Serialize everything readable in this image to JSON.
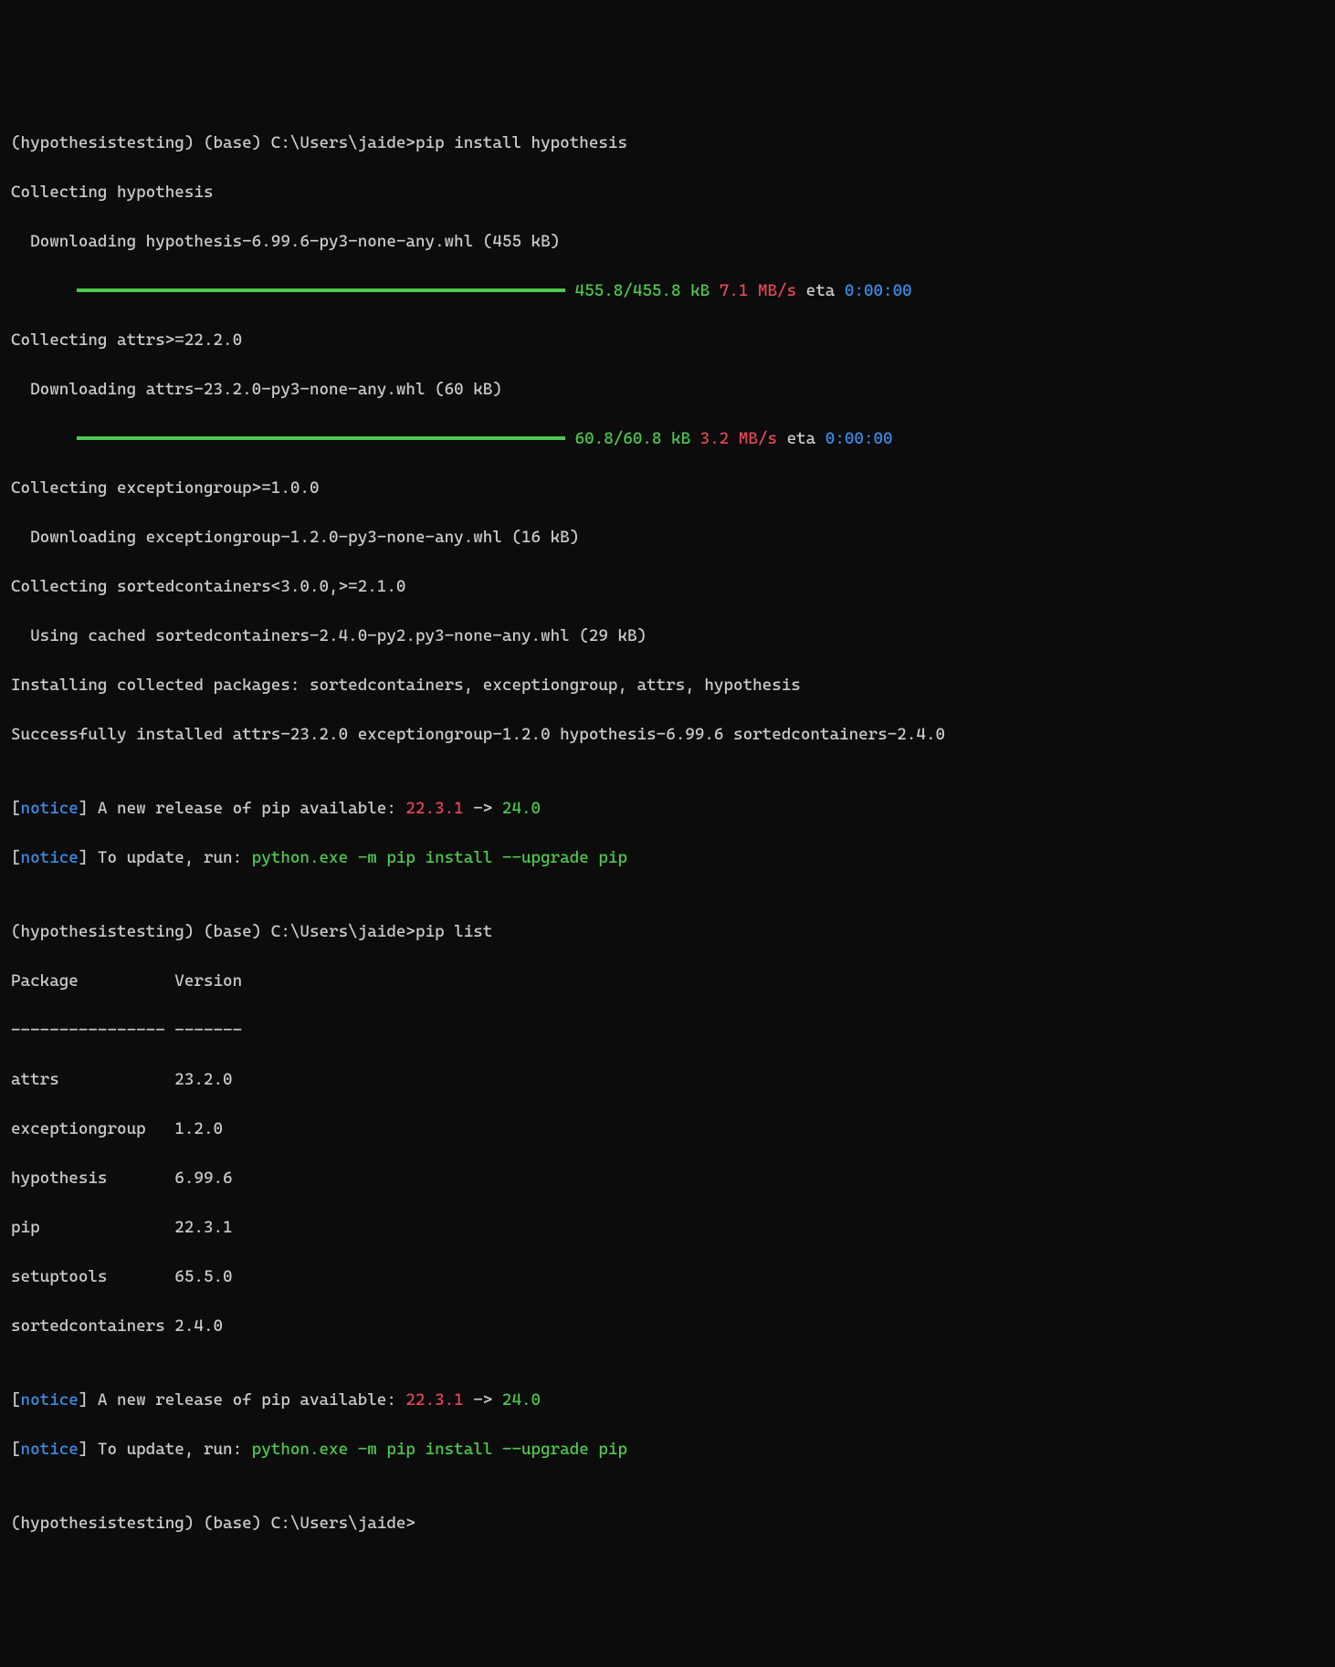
{
  "prompt": "(hypothesistesting) (base) C:\\Users\\jaide>",
  "cmd1": "pip install hypothesis",
  "cmd2": "pip list",
  "collecting_hypothesis": "Collecting hypothesis",
  "download_hypothesis": "  Downloading hypothesis-6.99.6-py3-none-any.whl (455 kB)",
  "progress1_size": "455.8/455.8 kB",
  "progress1_speed": "7.1 MB/s",
  "progress1_eta_label": "eta",
  "progress1_eta": "0:00:00",
  "collecting_attrs": "Collecting attrs>=22.2.0",
  "download_attrs": "  Downloading attrs-23.2.0-py3-none-any.whl (60 kB)",
  "progress2_size": "60.8/60.8 kB",
  "progress2_speed": "3.2 MB/s",
  "progress2_eta_label": "eta",
  "progress2_eta": "0:00:00",
  "collecting_exceptiongroup": "Collecting exceptiongroup>=1.0.0",
  "download_exceptiongroup": "  Downloading exceptiongroup-1.2.0-py3-none-any.whl (16 kB)",
  "collecting_sorted": "Collecting sortedcontainers<3.0.0,>=2.1.0",
  "cached_sorted": "  Using cached sortedcontainers-2.4.0-py2.py3-none-any.whl (29 kB)",
  "installing": "Installing collected packages: sortedcontainers, exceptiongroup, attrs, hypothesis",
  "success": "Successfully installed attrs-23.2.0 exceptiongroup-1.2.0 hypothesis-6.99.6 sortedcontainers-2.4.0",
  "bracket_open": "[",
  "bracket_close": "]",
  "notice_label": "notice",
  "notice1_prefix": " A new release of pip available: ",
  "notice1_old": "22.3.1",
  "notice1_arrow": " -> ",
  "notice1_new": "24.0",
  "notice2_prefix": " To update, run: ",
  "notice2_cmd": "python.exe -m pip install --upgrade pip",
  "table_header": "Package          Version",
  "table_divider": "---------------- -------",
  "packages": [
    "attrs            23.2.0",
    "exceptiongroup   1.2.0",
    "hypothesis       6.99.6",
    "pip              22.3.1",
    "setuptools       65.5.0",
    "sortedcontainers 2.4.0"
  ],
  "blank": ""
}
